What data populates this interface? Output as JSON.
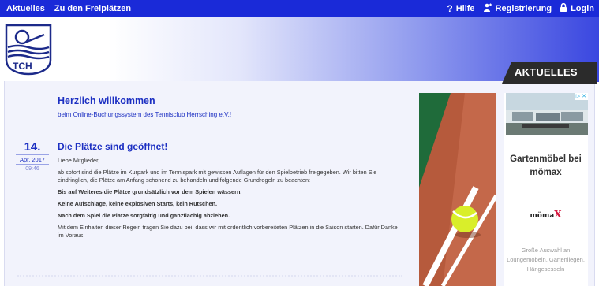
{
  "topbar": {
    "nav": [
      "Aktuelles",
      "Zu den Freiplätzen"
    ],
    "help": "Hilfe",
    "register": "Registrierung",
    "login": "Login"
  },
  "logo_text": "TCH",
  "section_tab": "AKTUELLES",
  "welcome": {
    "title": "Herzlich willkommen",
    "subtitle": "beim Online-Buchungssystem des Tennisclub Herrsching e.V.!"
  },
  "post": {
    "day": "14.",
    "month_year": "Apr. 2017",
    "time": "09:46",
    "title": "Die Plätze sind geöffnet!",
    "paragraphs": [
      {
        "text": "Liebe Mitglieder,",
        "bold": false
      },
      {
        "text": "ab sofort sind die Plätze im Kurpark und im Tennispark mit gewissen Auflagen für den Spielbetrieb freigegeben. Wir bitten Sie eindringlich, die Plätze am Anfang schonend zu behandeln und folgende Grundregeln zu beachten:",
        "bold": false
      },
      {
        "text": "Bis auf Weiteres die Plätze grundsätzlich vor dem Spielen wässern.",
        "bold": true
      },
      {
        "text": "Keine Aufschläge, keine explosiven Starts, kein Rutschen.",
        "bold": true
      },
      {
        "text": "Nach dem Spiel die Plätze sorgfältig und ganzflächig abziehen.",
        "bold": true
      },
      {
        "text": "Mit dem Einhalten dieser Regeln tragen Sie dazu bei, dass wir mit ordentlich vorbereiteten Plätzen in die Saison starten. Dafür Danke im Voraus!",
        "bold": false
      }
    ]
  },
  "ad": {
    "headline": "Gartenmöbel bei mömax",
    "brand_prefix": "möma",
    "brand_x": "X",
    "description": "Große Auswahl an Loungemöbeln, Gartenliegen, Hängesesseln"
  },
  "colors": {
    "topbar": "#1a2ad8",
    "accent": "#1c2fc2",
    "tab": "#2b2b2b"
  }
}
